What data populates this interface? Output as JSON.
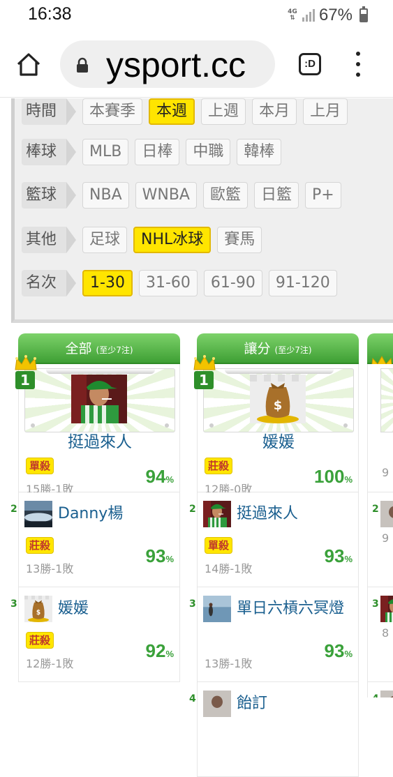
{
  "status_bar": {
    "time": "16:38",
    "network": "4G",
    "battery": "67%"
  },
  "browser": {
    "url": "ysport.cc",
    "tab_button": ":D"
  },
  "filters": {
    "rows": [
      {
        "label": "時間",
        "chips": [
          {
            "text": "本賽季",
            "active": false
          },
          {
            "text": "本週",
            "active": true
          },
          {
            "text": "上週",
            "active": false
          },
          {
            "text": "本月",
            "active": false
          },
          {
            "text": "上月",
            "active": false
          }
        ]
      },
      {
        "label": "棒球",
        "chips": [
          {
            "text": "MLB",
            "active": false
          },
          {
            "text": "日棒",
            "active": false
          },
          {
            "text": "中職",
            "active": false
          },
          {
            "text": "韓棒",
            "active": false
          }
        ]
      },
      {
        "label": "籃球",
        "chips": [
          {
            "text": "NBA",
            "active": false
          },
          {
            "text": "WNBA",
            "active": false
          },
          {
            "text": "歐籃",
            "active": false
          },
          {
            "text": "日籃",
            "active": false
          },
          {
            "text": "P+",
            "active": false
          }
        ]
      },
      {
        "label": "其他",
        "chips": [
          {
            "text": "足球",
            "active": false
          },
          {
            "text": "NHL冰球",
            "active": true
          },
          {
            "text": "賽馬",
            "active": false
          }
        ]
      },
      {
        "label": "名次",
        "chips": [
          {
            "text": "1-30",
            "active": true
          },
          {
            "text": "31-60",
            "active": false
          },
          {
            "text": "61-90",
            "active": false
          },
          {
            "text": "91-120",
            "active": false
          }
        ]
      }
    ]
  },
  "columns": [
    {
      "title": "全部",
      "subtitle": "(至少7注)",
      "champion": {
        "rank": "1",
        "name": "挺過來人",
        "tag": "單殺",
        "record": "15勝-1敗",
        "pct": "94",
        "pct_unit": "%",
        "avatar": "man-green-cap"
      },
      "items": [
        {
          "rank": "2",
          "name": "Danny楊",
          "tag": "莊殺",
          "record": "13勝-1敗",
          "pct": "93",
          "pct_unit": "%",
          "avatar": "landscape"
        },
        {
          "rank": "3",
          "name": "媛媛",
          "tag": "莊殺",
          "record": "12勝-1敗",
          "pct": "92",
          "pct_unit": "%",
          "avatar": "money-bag"
        }
      ]
    },
    {
      "title": "讓分",
      "subtitle": "(至少7注)",
      "champion": {
        "rank": "1",
        "name": "媛媛",
        "tag": "莊殺",
        "record": "12勝-0敗",
        "pct": "100",
        "pct_unit": "%",
        "avatar": "money-bag"
      },
      "items": [
        {
          "rank": "2",
          "name": "挺過來人",
          "tag": "單殺",
          "record": "14勝-1敗",
          "pct": "93",
          "pct_unit": "%",
          "avatar": "man-green-cap"
        },
        {
          "rank": "3",
          "name": "單日六槓六冥燈",
          "tag": "",
          "record": "13勝-1敗",
          "pct": "93",
          "pct_unit": "%",
          "avatar": "person-sea"
        },
        {
          "rank": "4",
          "name": "飴訂",
          "tag": "",
          "record": "",
          "pct": "",
          "pct_unit": "",
          "avatar": "portrait"
        }
      ]
    },
    {
      "partial_ranks": [
        "1",
        "2",
        "3",
        "4"
      ],
      "partial_records": [
        "9",
        "9",
        "8"
      ]
    }
  ]
}
